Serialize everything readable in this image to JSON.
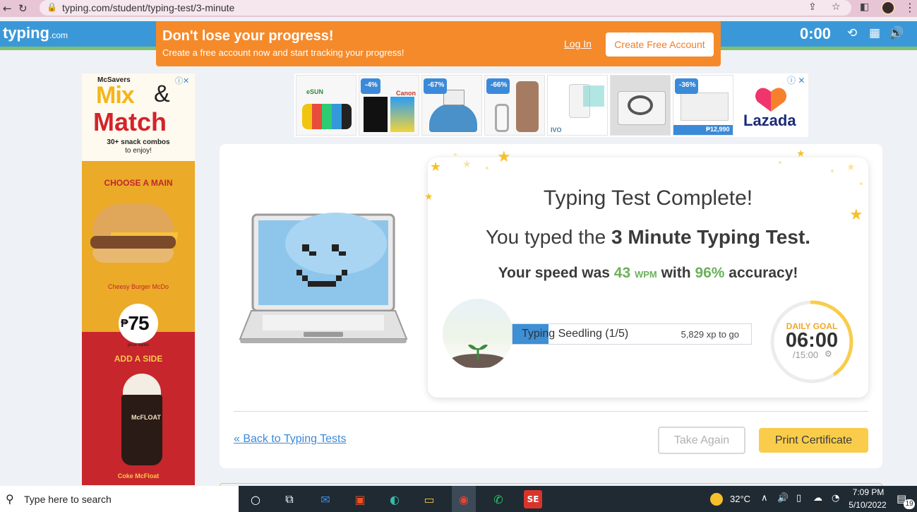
{
  "browser": {
    "url": "typing.com/student/typing-test/3-minute",
    "icons": [
      "back-arrow-icon",
      "reload-icon",
      "lock-icon",
      "share-icon",
      "bookmark-star-icon",
      "side-panel-icon",
      "profile-avatar",
      "kebab-menu-icon"
    ]
  },
  "site": {
    "logo": "typing",
    "logo_suffix": ".com",
    "timer": "0:00",
    "header_icons": [
      "history-icon",
      "stats-icon",
      "volume-icon"
    ],
    "accent_blue": "#3b98d8",
    "accent_green": "#7cc06f"
  },
  "promo": {
    "title": "Don't lose your progress!",
    "subtitle": "Create a free account now and start tracking your progress!",
    "login_label": "Log In",
    "create_label": "Create Free Account",
    "color": "#f58a2b"
  },
  "left_ad": {
    "brand": "McSavers",
    "mix": "Mix",
    "amp": "&",
    "match": "Match",
    "combos": "30+ snack combos",
    "enjoy": "to enjoy!",
    "choose_main": "CHOOSE A MAIN",
    "burger_name": "Cheesy Burger McDo",
    "price_symbol": "₱",
    "price": "75",
    "price_note": "price varies",
    "add_side": "ADD A SIDE",
    "cup_label": "McFLOAT",
    "side_name": "Coke McFloat"
  },
  "top_ad": {
    "tiles": [
      {
        "badge": "",
        "text": "eSUN"
      },
      {
        "badge": "-4%",
        "text": "Canon"
      },
      {
        "badge": "-67%",
        "text": ""
      },
      {
        "badge": "-66%",
        "text": ""
      },
      {
        "badge": "",
        "text": "IVO"
      },
      {
        "badge": "",
        "text": ""
      },
      {
        "badge": "-36%",
        "text": "₱12,990"
      }
    ],
    "brand": "Lazada"
  },
  "result": {
    "title": "Typing Test Complete!",
    "test_prefix": "You typed the ",
    "test_name": "3 Minute Typing Test.",
    "speed_prefix": "Your speed was ",
    "wpm_value": "43",
    "wpm_unit": "WPM",
    "speed_mid": " with ",
    "accuracy": "96%",
    "speed_suffix": " accuracy!",
    "level_label": "Typing Seedling (1/5)",
    "xp_to_go": "5,829 xp to go",
    "level_progress_fraction": 0.15
  },
  "daily_goal": {
    "label": "DAILY GOAL",
    "time": "06:00",
    "total": "/15:00",
    "progress_fraction": 0.4,
    "color": "#f9cd4b"
  },
  "actions": {
    "back_label": "« Back to Typing Tests",
    "take_again_label": "Take Again",
    "print_label": "Print Certificate"
  },
  "taskbar": {
    "search_placeholder": "Type here to search",
    "apps": [
      "cortana-icon",
      "task-view-icon",
      "mail-icon",
      "store-icon",
      "edge-icon",
      "file-explorer-icon",
      "chrome-icon",
      "whatsapp-icon",
      "app-se-icon"
    ],
    "temperature": "32°C",
    "time": "7:09 PM",
    "date": "5/10/2022",
    "notification_count": "19"
  }
}
